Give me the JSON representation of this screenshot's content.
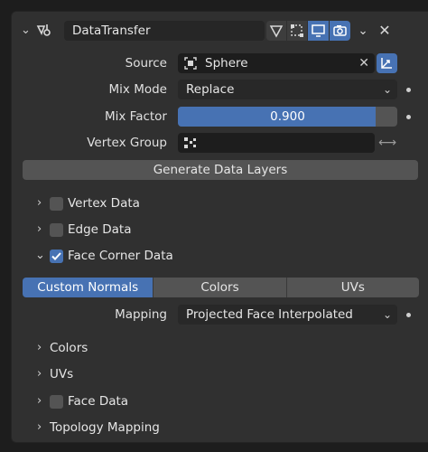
{
  "header": {
    "modifier_name": "DataTransfer",
    "icons": [
      "modifier-data-transfer-icon",
      "edit-mode-icon",
      "cage-icon",
      "viewport-display-icon",
      "render-icon",
      "dropdown-menu-icon",
      "close-icon"
    ]
  },
  "properties": {
    "source_label": "Source",
    "source_value": "Sphere",
    "mix_mode_label": "Mix Mode",
    "mix_mode_value": "Replace",
    "mix_factor_label": "Mix Factor",
    "mix_factor_value": "0.900",
    "mix_factor_fraction": 0.9,
    "vertex_group_label": "Vertex Group",
    "vertex_group_value": ""
  },
  "generate_button": "Generate Data Layers",
  "sections": {
    "vertex_data": "Vertex Data",
    "edge_data": "Edge Data",
    "face_corner_data": "Face Corner Data"
  },
  "face_corner": {
    "tabs": [
      "Custom Normals",
      "Colors",
      "UVs"
    ],
    "active_tab": "Custom Normals",
    "mapping_label": "Mapping",
    "mapping_value": "Projected Face Interpolated",
    "sub_colors": "Colors",
    "sub_uvs": "UVs"
  },
  "face_data": "Face Data",
  "topology_mapping": "Topology Mapping",
  "colors": {
    "accent": "#4772b3",
    "panel_bg": "#303030",
    "field_bg": "#1d1d1d"
  }
}
